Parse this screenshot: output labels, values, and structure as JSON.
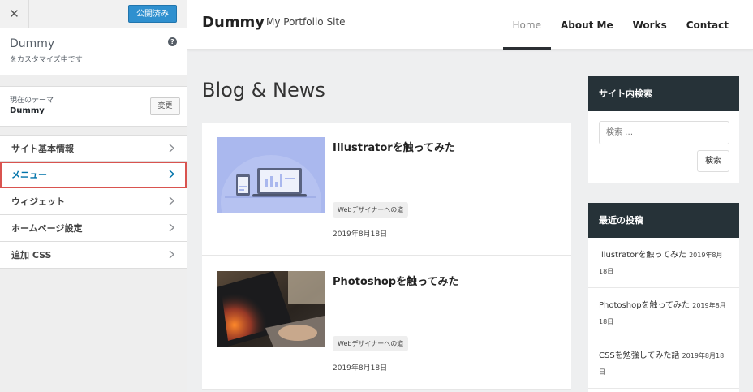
{
  "customizer": {
    "close_glyph": "✕",
    "publish_label": "公開済み",
    "site_name": "Dummy",
    "customizing_text": "をカスタマイズ中です",
    "help_glyph": "?",
    "theme_label": "現在のテーマ",
    "theme_name": "Dummy",
    "change_label": "変更",
    "menu": [
      {
        "label": "サイト基本情報"
      },
      {
        "label": "メニュー"
      },
      {
        "label": "ウィジェット"
      },
      {
        "label": "ホームページ設定"
      },
      {
        "label": "追加 CSS"
      }
    ],
    "colors": {
      "publish": "#2f90cf",
      "highlight": "#d9534f"
    }
  },
  "preview": {
    "logo": "Dummy",
    "tagline": "My Portfolio Site",
    "nav": [
      {
        "label": "Home",
        "current": true
      },
      {
        "label": "About Me"
      },
      {
        "label": "Works"
      },
      {
        "label": "Contact"
      }
    ],
    "blog_title": "Blog & News",
    "posts": [
      {
        "title": "Illustratorを触ってみた",
        "tag": "Webデザイナーへの道",
        "date": "2019年8月18日",
        "thumb_icon": "devices-illustration-icon"
      },
      {
        "title": "Photoshopを触ってみた",
        "tag": "Webデザイナーへの道",
        "date": "2019年8月18日",
        "thumb_icon": "laptop-photo-icon"
      }
    ],
    "search_widget": {
      "title": "サイト内検索",
      "placeholder": "検索 …",
      "button": "検索"
    },
    "recent_widget": {
      "title": "最近の投稿",
      "items": [
        {
          "title": "Illustratorを触ってみた",
          "date": "2019年8月18日"
        },
        {
          "title": "Photoshopを触ってみた",
          "date": "2019年8月18日"
        },
        {
          "title": "CSSを勉強してみた話",
          "date": "2019年8月18日"
        }
      ]
    },
    "colors": {
      "widget_header": "#263238",
      "nav_underline": "#2b2f33"
    }
  }
}
